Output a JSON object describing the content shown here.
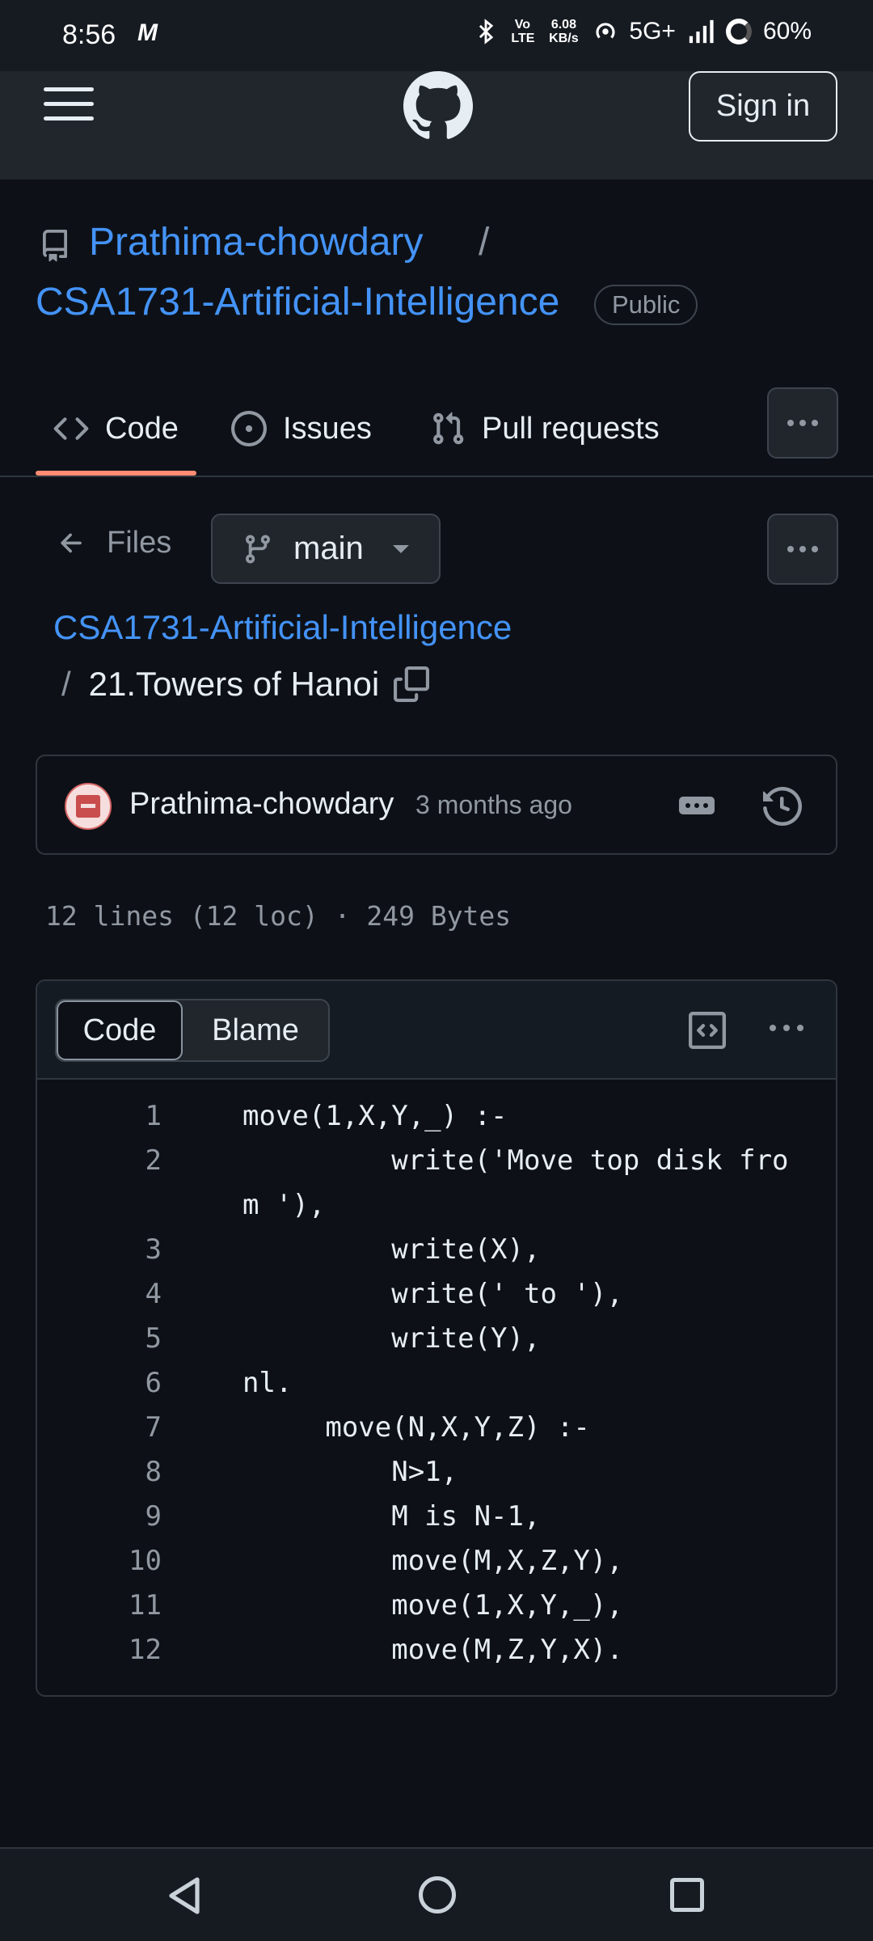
{
  "status_bar": {
    "time": "8:56",
    "carrier_glyph": "M",
    "volte": "Vo LTE",
    "speed": "6.08 KB/s",
    "network": "5G+",
    "battery": "60%"
  },
  "header": {
    "sign_in_label": "Sign in"
  },
  "repo": {
    "owner": "Prathima-chowdary",
    "separator": "/",
    "name": "CSA1731-Artificial-Intelligence",
    "visibility": "Public"
  },
  "tabs": [
    {
      "label": "Code",
      "icon": "code-icon",
      "active": true
    },
    {
      "label": "Issues",
      "icon": "issue-opened-icon"
    },
    {
      "label": "Pull requests",
      "icon": "git-pull-request-icon"
    }
  ],
  "file_nav": {
    "files_label": "Files",
    "branch": "main"
  },
  "breadcrumb": {
    "repo": "CSA1731-Artificial-Intelligence",
    "separator": "/",
    "file": "21.Towers of Hanoi"
  },
  "commit": {
    "author": "Prathima-chowdary",
    "time": "3 months ago"
  },
  "file_meta": "12 lines (12 loc) · 249 Bytes",
  "code_view": {
    "tab_code": "Code",
    "tab_blame": "Blame",
    "lines": [
      {
        "n": "1",
        "text": "move(1,X,Y,_) :-"
      },
      {
        "n": "2",
        "text": "         write('Move top disk from '),"
      },
      {
        "n": "3",
        "text": "         write(X),"
      },
      {
        "n": "4",
        "text": "         write(' to '),"
      },
      {
        "n": "5",
        "text": "         write(Y),"
      },
      {
        "n": "6",
        "text": "nl."
      },
      {
        "n": "7",
        "text": "     move(N,X,Y,Z) :-"
      },
      {
        "n": "8",
        "text": "         N>1,"
      },
      {
        "n": "9",
        "text": "         M is N-1,"
      },
      {
        "n": "10",
        "text": "         move(M,X,Z,Y),"
      },
      {
        "n": "11",
        "text": "         move(1,X,Y,_),"
      },
      {
        "n": "12",
        "text": "         move(M,Z,Y,X)."
      }
    ]
  },
  "colors": {
    "background": "#0d1117",
    "link": "#4493f8",
    "active_tab_underline": "#fd8c73"
  }
}
